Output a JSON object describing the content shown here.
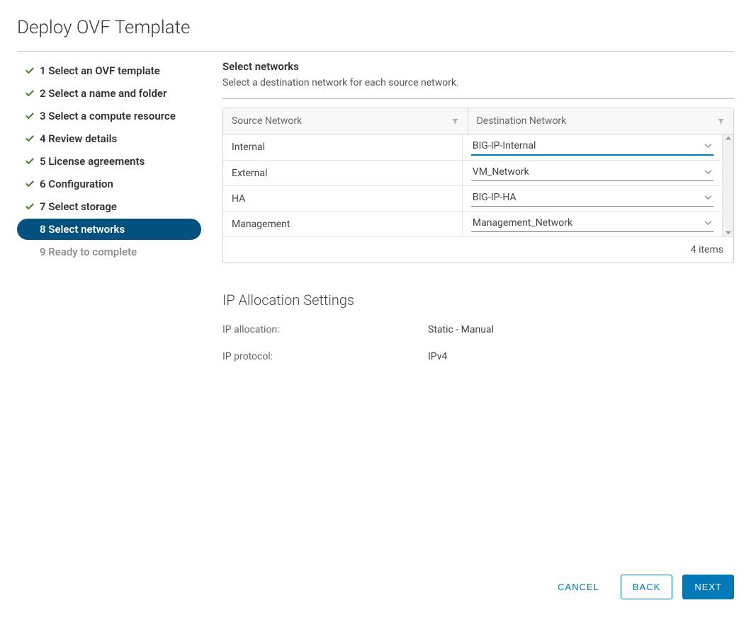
{
  "dialog": {
    "title": "Deploy OVF Template"
  },
  "wizard": {
    "steps": [
      {
        "label": "1 Select an OVF template",
        "state": "completed"
      },
      {
        "label": "2 Select a name and folder",
        "state": "completed"
      },
      {
        "label": "3 Select a compute resource",
        "state": "completed"
      },
      {
        "label": "4 Review details",
        "state": "completed"
      },
      {
        "label": "5 License agreements",
        "state": "completed"
      },
      {
        "label": "6 Configuration",
        "state": "completed"
      },
      {
        "label": "7 Select storage",
        "state": "completed"
      },
      {
        "label": "8 Select networks",
        "state": "current"
      },
      {
        "label": "9 Ready to complete",
        "state": "pending"
      }
    ]
  },
  "panel": {
    "title": "Select networks",
    "description": "Select a destination network for each source network."
  },
  "networks_table": {
    "headers": {
      "source": "Source Network",
      "dest": "Destination Network"
    },
    "rows": [
      {
        "source": "Internal",
        "dest": "BIG-IP-Internal",
        "active": true
      },
      {
        "source": "External",
        "dest": "VM_Network",
        "active": false
      },
      {
        "source": "HA",
        "dest": "BIG-IP-HA",
        "active": false
      },
      {
        "source": "Management",
        "dest": "Management_Network",
        "active": false
      }
    ],
    "footer": "4 items"
  },
  "ip_settings": {
    "heading": "IP Allocation Settings",
    "rows": [
      {
        "label": "IP allocation:",
        "value": "Static - Manual"
      },
      {
        "label": "IP protocol:",
        "value": "IPv4"
      }
    ]
  },
  "buttons": {
    "cancel": "CANCEL",
    "back": "BACK",
    "next": "NEXT"
  }
}
